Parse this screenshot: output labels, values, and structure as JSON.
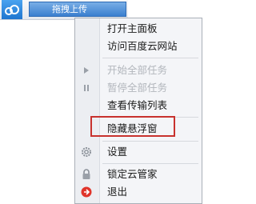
{
  "floatbar": {
    "icon": "cloud-icon",
    "label": "拖拽上传"
  },
  "menu": {
    "items": [
      {
        "label": "打开主面板",
        "enabled": true,
        "icon": null
      },
      {
        "label": "访问百度云网站",
        "enabled": true,
        "icon": null
      },
      {
        "label": "开始全部任务",
        "enabled": false,
        "icon": "play-icon"
      },
      {
        "label": "暂停全部任务",
        "enabled": false,
        "icon": "pause-icon"
      },
      {
        "label": "查看传输列表",
        "enabled": true,
        "icon": null
      },
      {
        "label": "隐藏悬浮窗",
        "enabled": true,
        "icon": null
      },
      {
        "label": "设置",
        "enabled": true,
        "icon": "gear-icon"
      },
      {
        "label": "锁定云管家",
        "enabled": true,
        "icon": "lock-icon"
      },
      {
        "label": "退出",
        "enabled": true,
        "icon": "exit-icon"
      }
    ]
  },
  "colors": {
    "accent": "#2e7fd6",
    "highlight_box": "#c8322e",
    "exit_red": "#e0342a",
    "disabled_text": "#b2b6bc"
  }
}
